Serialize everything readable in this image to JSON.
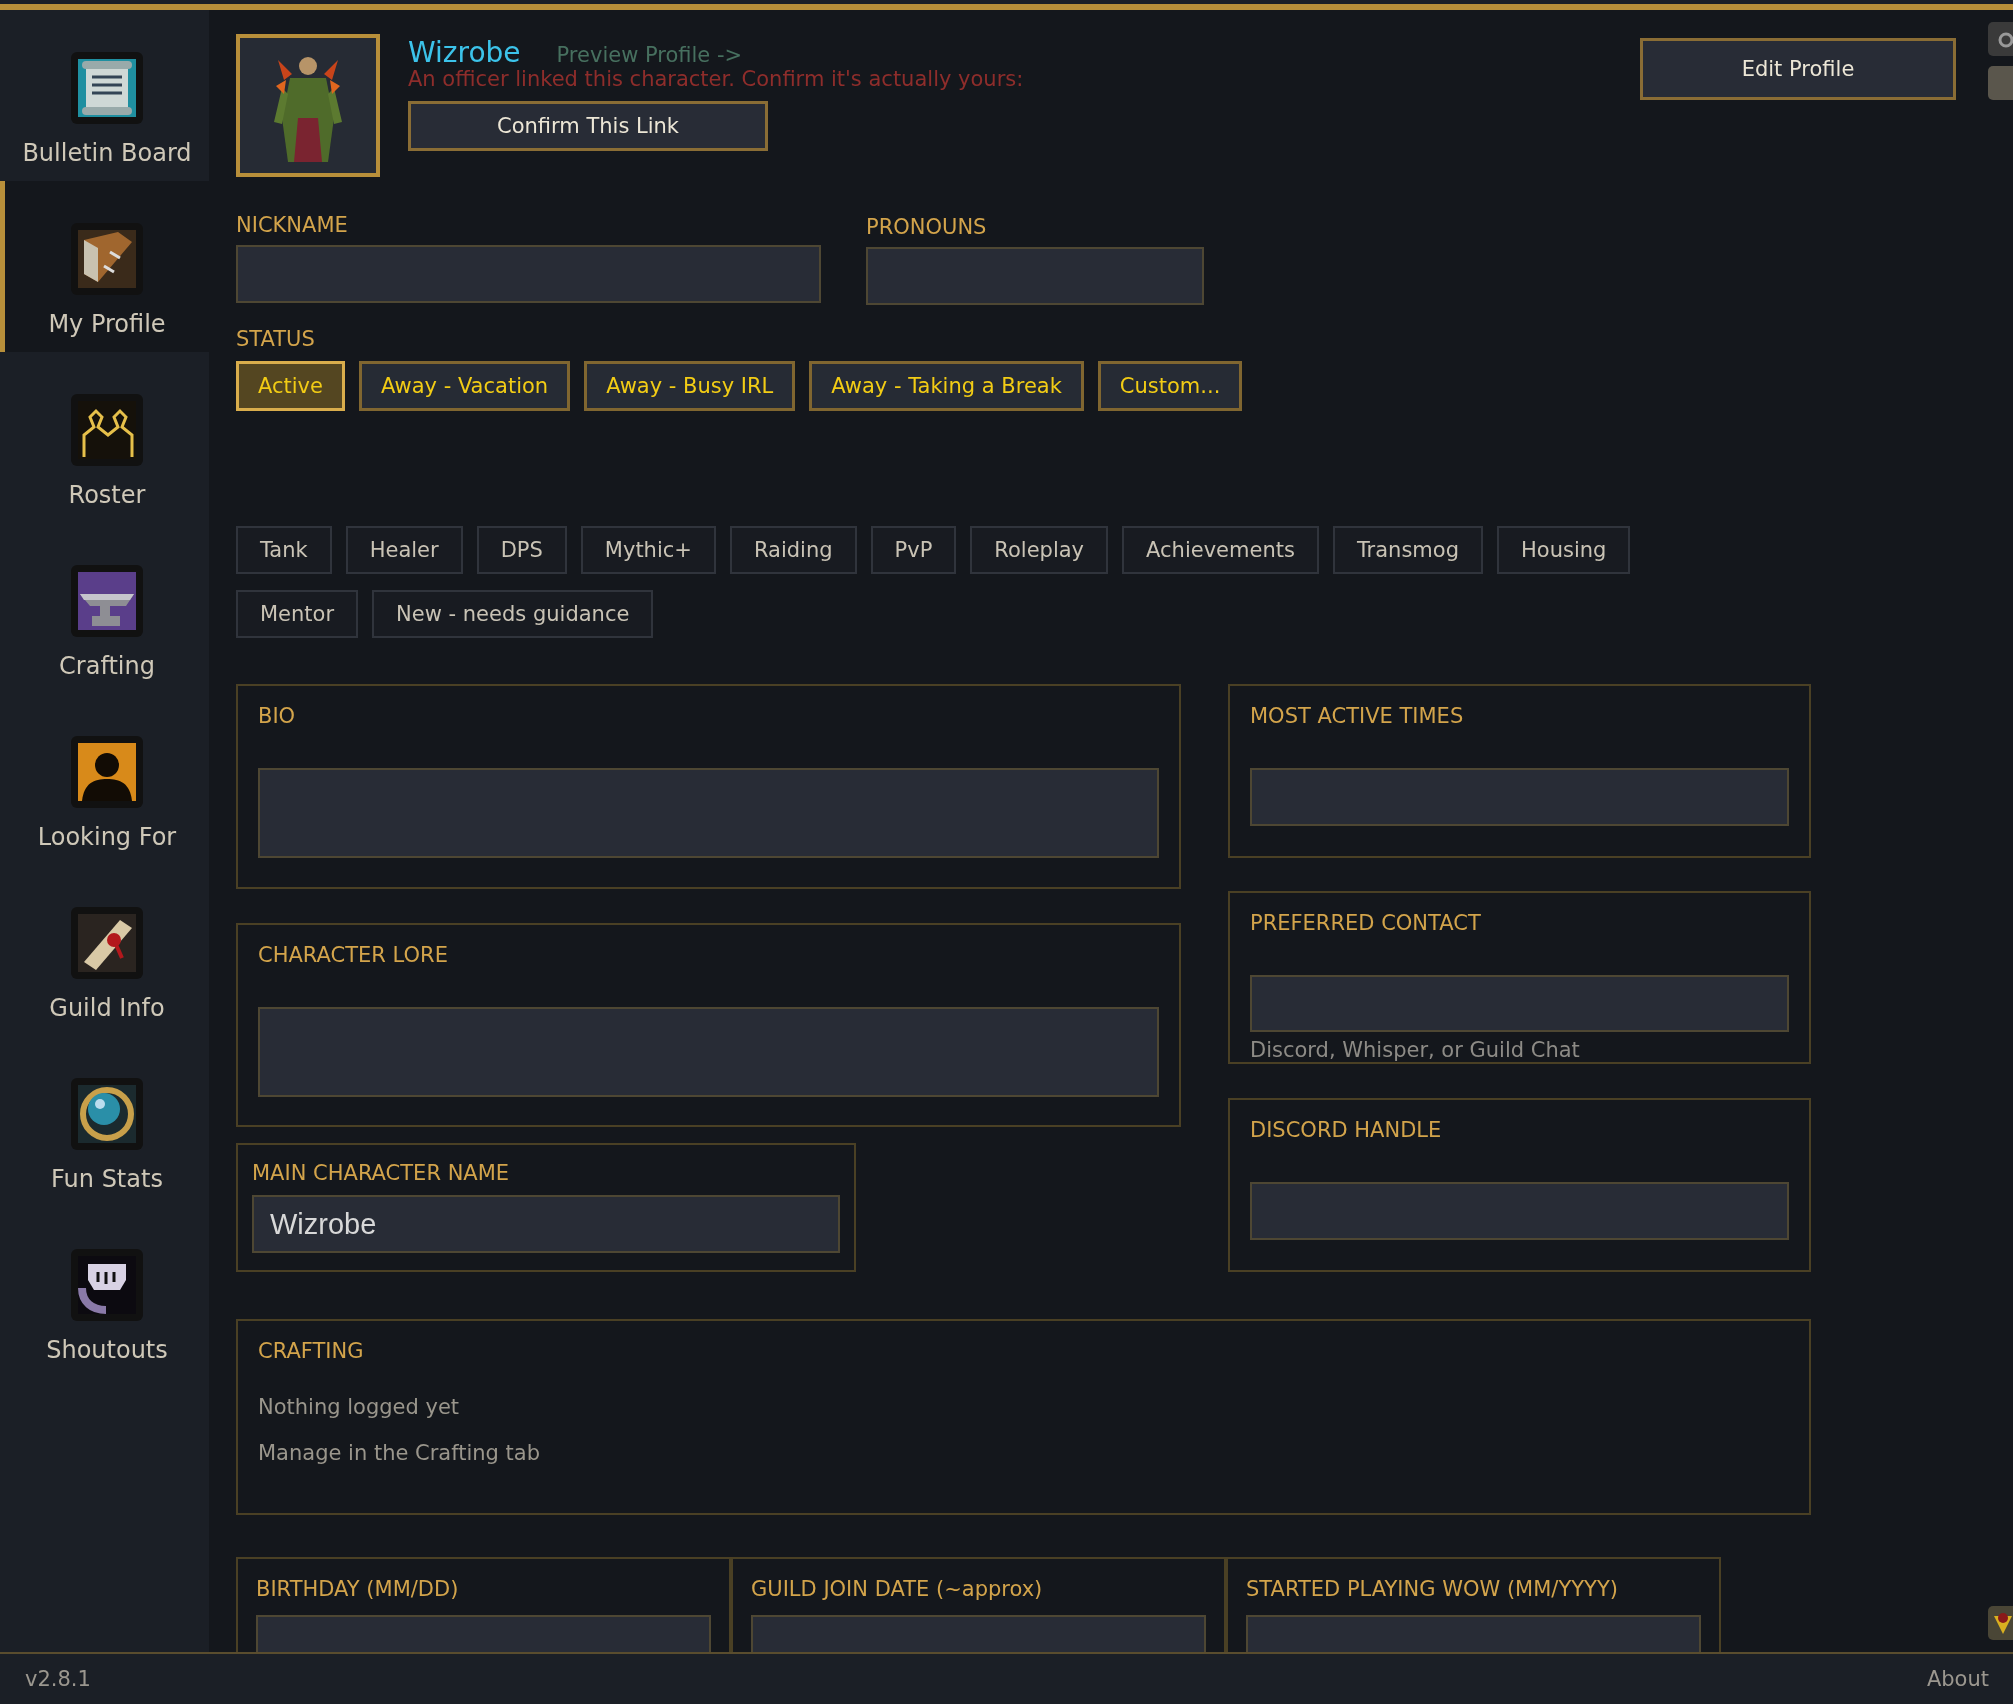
{
  "sidebar": {
    "items": [
      {
        "label": "Bulletin Board",
        "selected": false
      },
      {
        "label": "My Profile",
        "selected": true
      },
      {
        "label": "Roster",
        "selected": false
      },
      {
        "label": "Crafting",
        "selected": false
      },
      {
        "label": "Looking For",
        "selected": false
      },
      {
        "label": "Guild Info",
        "selected": false
      },
      {
        "label": "Fun Stats",
        "selected": false
      },
      {
        "label": "Shoutouts",
        "selected": false
      }
    ]
  },
  "profile": {
    "character_name": "Wizrobe",
    "preview_link": "Preview Profile ->",
    "warning": "An officer linked this character. Confirm it's actually yours:",
    "confirm_button": "Confirm This Link",
    "edit_button": "Edit Profile"
  },
  "fields": [
    {
      "label": "NICKNAME"
    },
    {
      "label": "PRONOUNS"
    }
  ],
  "status": {
    "label": "STATUS",
    "options": [
      {
        "label": "Active",
        "selected": true
      },
      {
        "label": "Away - Vacation",
        "selected": false
      },
      {
        "label": "Away - Busy IRL",
        "selected": false
      },
      {
        "label": "Away - Taking a Break",
        "selected": false
      },
      {
        "label": "Custom...",
        "selected": false
      }
    ]
  },
  "tags": [
    {
      "label": "Tank"
    },
    {
      "label": "Healer"
    },
    {
      "label": "DPS"
    },
    {
      "label": "Mythic+"
    },
    {
      "label": "Raiding"
    },
    {
      "label": "PvP"
    },
    {
      "label": "Roleplay"
    },
    {
      "label": "Achievements"
    },
    {
      "label": "Transmog"
    },
    {
      "label": "Housing"
    },
    {
      "label": "Mentor"
    },
    {
      "label": "New - needs guidance"
    }
  ],
  "left_cards": [
    {
      "label": "BIO",
      "kind": "textarea"
    },
    {
      "label": "CHARACTER LORE",
      "kind": "textarea"
    },
    {
      "label": "MAIN CHARACTER NAME",
      "kind": "input",
      "value": "Wizrobe"
    }
  ],
  "right_cards": [
    {
      "label": "MOST ACTIVE TIMES",
      "kind": "input"
    },
    {
      "label": "PREFERRED CONTACT",
      "kind": "input",
      "hint": "Discord, Whisper, or Guild Chat"
    },
    {
      "label": "DISCORD HANDLE",
      "kind": "input"
    }
  ],
  "crafting": {
    "label": "CRAFTING",
    "lines": [
      "Nothing logged yet",
      "Manage in the Crafting tab"
    ]
  },
  "date_cards": [
    {
      "label": "BIRTHDAY (MM/DD)"
    },
    {
      "label": "GUILD JOIN DATE (~approx)"
    },
    {
      "label": "STARTED PLAYING WOW (MM/YYYY)"
    }
  ],
  "status_bar": {
    "version": "v2.8.1",
    "about": "About"
  }
}
